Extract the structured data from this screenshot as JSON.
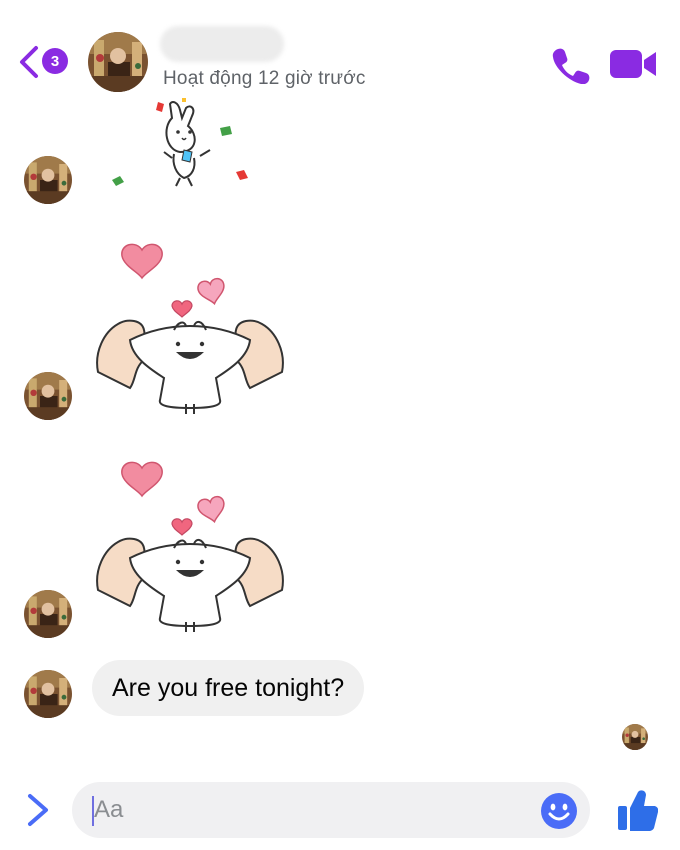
{
  "header": {
    "back_badge_count": "3",
    "contact_status": "Hoạt động 12 giờ trước",
    "icons": {
      "back": "chevron-left-icon",
      "call": "phone-icon",
      "video": "video-camera-icon"
    }
  },
  "messages": [
    {
      "type": "sticker",
      "sticker": "confetti-bunny",
      "from": "contact"
    },
    {
      "type": "sticker",
      "sticker": "hearts-bunny-hug",
      "from": "contact"
    },
    {
      "type": "sticker",
      "sticker": "hearts-bunny-hug",
      "from": "contact"
    },
    {
      "type": "text",
      "text": "Are you free tonight?",
      "from": "contact"
    }
  ],
  "composer": {
    "placeholder": "Aa",
    "icons": {
      "expand": "chevron-right-icon",
      "emoji": "smiley-icon",
      "like": "thumbs-up-icon"
    }
  },
  "colors": {
    "accent": "#8a2be2",
    "emoji_blue": "#4a6cf7",
    "like_blue": "#2e6ee8",
    "bubble_bg": "#f0f0f0",
    "heart_pink": "#f28ca0"
  }
}
